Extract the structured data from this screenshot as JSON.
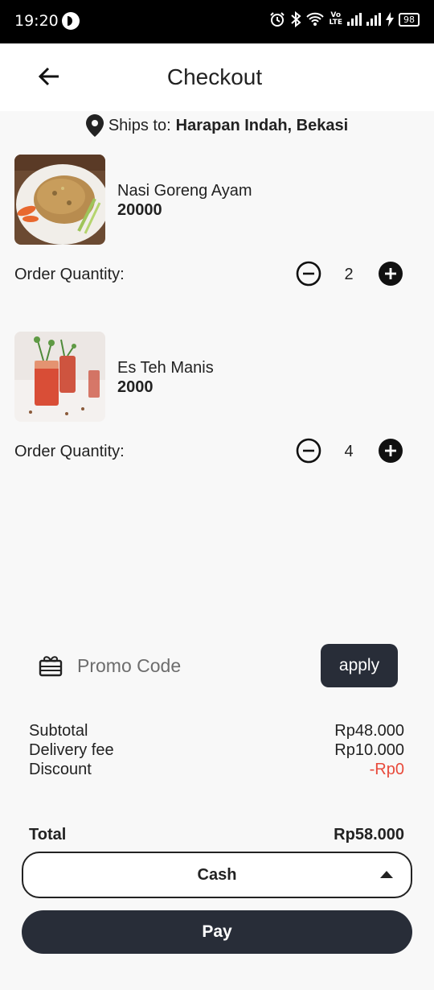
{
  "status_bar": {
    "time": "19:20",
    "battery": "98",
    "volte": "Vo LTE"
  },
  "header": {
    "title": "Checkout"
  },
  "shipping": {
    "label": "Ships to:",
    "location": "Harapan Indah, Bekasi"
  },
  "items": [
    {
      "name": "Nasi Goreng Ayam",
      "price": "20000",
      "qty_label": "Order Quantity:",
      "quantity": "2",
      "image": "fried-rice-photo"
    },
    {
      "name": "Es Teh Manis",
      "price": "2000",
      "qty_label": "Order Quantity:",
      "quantity": "4",
      "image": "iced-tea-photo"
    }
  ],
  "promo": {
    "placeholder": "Promo Code",
    "apply_label": "apply",
    "icon": "gift-card-icon"
  },
  "summary": {
    "subtotal_label": "Subtotal",
    "subtotal_value": "Rp48.000",
    "delivery_label": "Delivery fee",
    "delivery_value": "Rp10.000",
    "discount_label": "Discount",
    "discount_value": "-Rp0",
    "total_label": "Total",
    "total_value": "Rp58.000"
  },
  "payment": {
    "selected": "Cash"
  },
  "pay_button": {
    "label": "Pay"
  },
  "colors": {
    "primary_dark": "#282d38",
    "discount_red": "#e84a3b",
    "background": "#f8f8f8"
  }
}
